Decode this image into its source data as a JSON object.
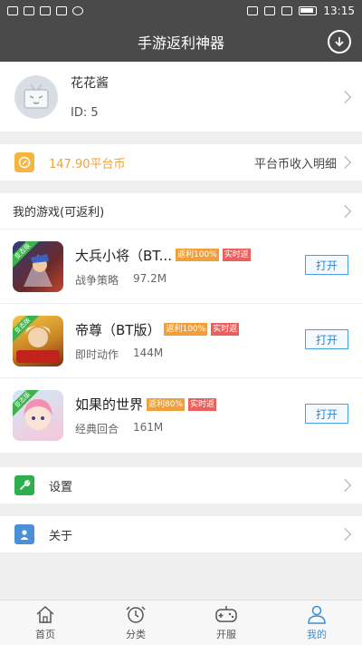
{
  "status_bar": {
    "time": "13:15"
  },
  "header": {
    "title": "手游返利神器"
  },
  "profile": {
    "name": "花花酱",
    "id_label": "ID: 5"
  },
  "coins": {
    "amount": "147.90平台币",
    "detail_link": "平台币收入明细"
  },
  "games_section": {
    "title": "我的游戏(可返利)"
  },
  "games": [
    {
      "name": "大兵小将（BT...",
      "rebate_tag": "返利100%",
      "realtime_tag": "实时返",
      "genre": "战争策略",
      "size": "97.2M",
      "button": "打开",
      "ribbon": "变态版"
    },
    {
      "name": "帝尊（BT版）",
      "rebate_tag": "返利100%",
      "realtime_tag": "实时返",
      "genre": "即时动作",
      "size": "144M",
      "button": "打开",
      "ribbon": "变态版"
    },
    {
      "name": "如果的世界",
      "rebate_tag": "返利80%",
      "realtime_tag": "实时返",
      "genre": "经典回合",
      "size": "161M",
      "button": "打开",
      "ribbon": "变态版"
    }
  ],
  "menu": {
    "settings": "设置",
    "about": "关于"
  },
  "bottom_nav": [
    {
      "label": "首页",
      "icon": "home-icon"
    },
    {
      "label": "分类",
      "icon": "clock-icon"
    },
    {
      "label": "开服",
      "icon": "gamepad-icon"
    },
    {
      "label": "我的",
      "icon": "user-icon"
    }
  ],
  "colors": {
    "header": "#4a4a4a",
    "accent_blue": "#3b8fd6",
    "coin_orange": "#f0a03a",
    "tag_red": "#e9605e",
    "green": "#3bb34a"
  }
}
